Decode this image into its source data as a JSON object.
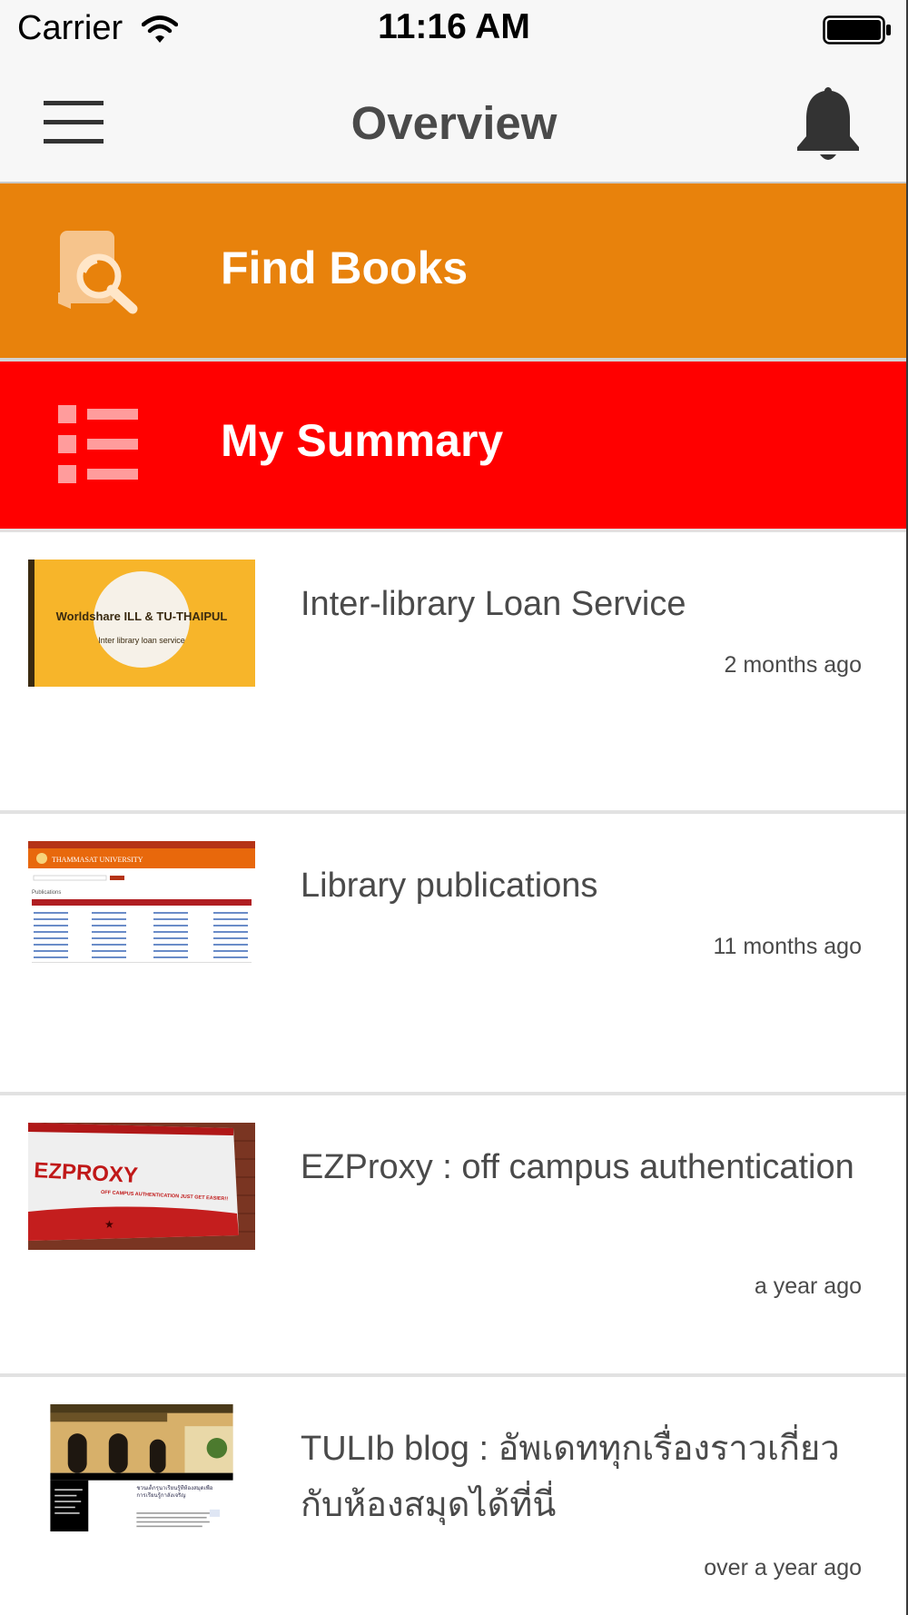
{
  "status_bar": {
    "carrier": "Carrier",
    "time": "11:16 AM",
    "icons": [
      "wifi-icon",
      "battery-icon"
    ]
  },
  "nav": {
    "title": "Overview",
    "left_icon": "menu-icon",
    "right_icon": "bell-icon"
  },
  "tiles": [
    {
      "label": "Find Books",
      "icon": "book-search-icon",
      "color": "#e8820c"
    },
    {
      "label": "My Summary",
      "icon": "list-icon",
      "color": "#ff0000"
    }
  ],
  "feed": [
    {
      "title": "Inter-library Loan Service",
      "time": "2 months ago",
      "thumb": {
        "heading": "Worldshare ILL & TU-THAIPUL",
        "subheading": "Inter library loan service"
      }
    },
    {
      "title": "Library publications",
      "time": "11 months ago",
      "thumb": {
        "heading": "THAMMASAT UNIVERSITY",
        "subheading": "Publications"
      }
    },
    {
      "title": "EZProxy : off campus authentication",
      "time": "a year ago",
      "thumb": {
        "heading": "EZPROXY",
        "subheading": "OFF CAMPUS AUTHENTICATION JUST GET EASIER!!"
      }
    },
    {
      "title": "TULIb blog : อัพเดททุกเรื่องราวเกี่ยวกับห้องสมุดได้ที่นี่",
      "time": "over a year ago",
      "thumb": {
        "heading": "ชวนเด็กรุนาเรียนรู้ที่ห้องสมุดเพื่อการเรียนรู้กาลังเจริญ"
      }
    }
  ],
  "colors": {
    "find_books": "#e8820c",
    "my_summary": "#ff0000",
    "nav_background": "#f7f7f7",
    "text": "#4a4a4a"
  }
}
